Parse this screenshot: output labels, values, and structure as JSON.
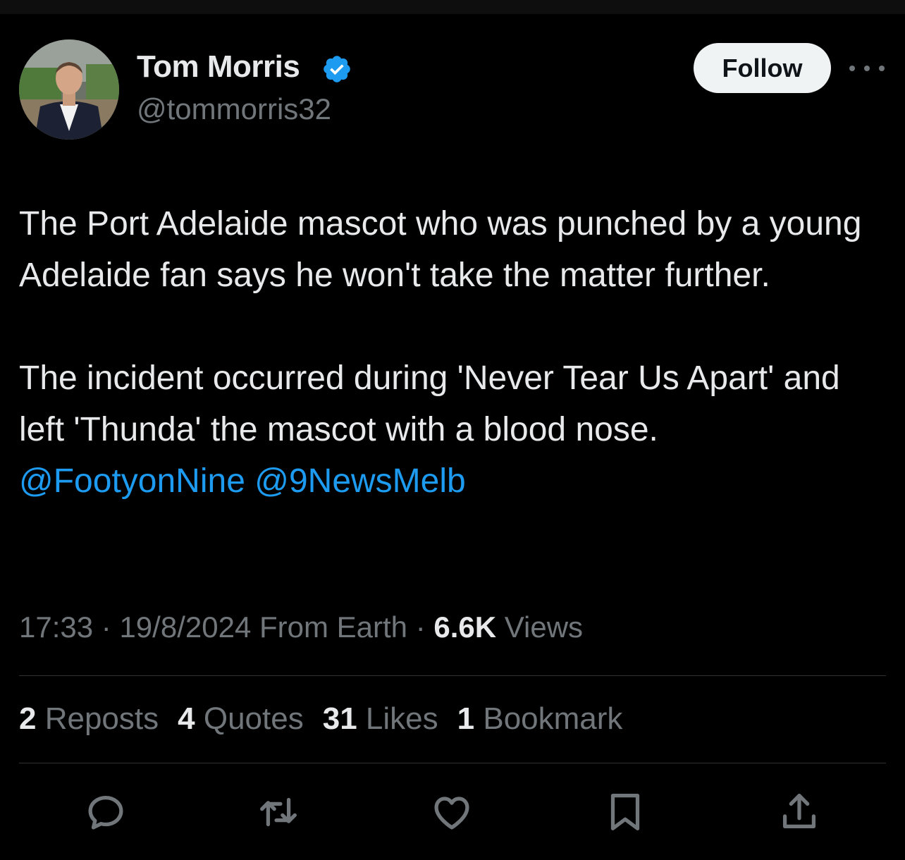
{
  "tweet": {
    "author": {
      "name": "Tom Morris",
      "handle": "@tommorris32",
      "verified": true
    },
    "follow_label": "Follow",
    "paragraphs": [
      "The Port Adelaide mascot who was punched by a young Adelaide fan says he won't take the matter further.",
      "The incident occurred during 'Never Tear Us Apart' and left 'Thunda' the mascot with a blood nose."
    ],
    "mentions": [
      "@FootyonNine",
      "@9NewsMelb"
    ],
    "meta": {
      "time": "17:33",
      "date": "19/8/2024",
      "source": "From Earth",
      "views_count": "6.6K",
      "views_label": "Views",
      "separator": "·"
    },
    "stats": [
      {
        "count": "2",
        "label": "Reposts"
      },
      {
        "count": "4",
        "label": "Quotes"
      },
      {
        "count": "31",
        "label": "Likes"
      },
      {
        "count": "1",
        "label": "Bookmark"
      }
    ],
    "actions": [
      "reply-icon",
      "repost-icon",
      "like-icon",
      "bookmark-icon",
      "share-icon"
    ]
  },
  "colors": {
    "background": "#000000",
    "text": "#e7e9ea",
    "secondary": "#71767b",
    "link": "#1d9bf0",
    "verified": "#1d9bf0",
    "divider": "#2f3336"
  }
}
